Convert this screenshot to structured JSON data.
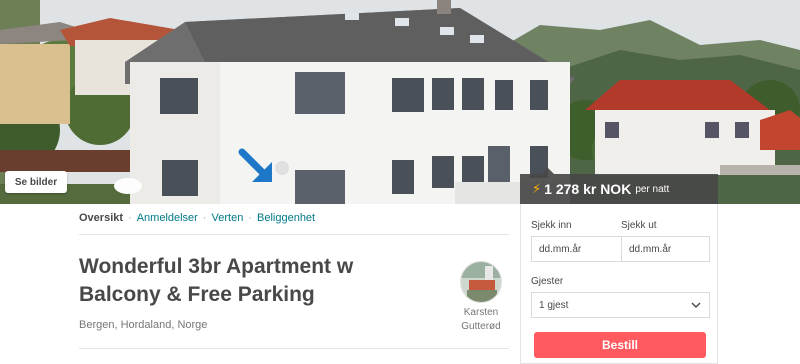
{
  "hero": {
    "see_photos_label": "Se bilder"
  },
  "price": {
    "amount": "1 278 kr NOK",
    "per_label": "per natt"
  },
  "subnav": {
    "items": [
      {
        "label": "Oversikt"
      },
      {
        "label": "Anmeldelser"
      },
      {
        "label": "Verten"
      },
      {
        "label": "Beliggenhet"
      }
    ],
    "separator": "·"
  },
  "listing": {
    "title_line1": "Wonderful 3br Apartment w",
    "title_line2": "Balcony & Free Parking",
    "location": "Bergen, Hordaland, Norge"
  },
  "host": {
    "first_name": "Karsten",
    "last_name": "Gutterød"
  },
  "booking": {
    "checkin_label": "Sjekk inn",
    "checkout_label": "Sjekk ut",
    "checkin_placeholder": "dd.mm.år",
    "checkout_placeholder": "dd.mm.år",
    "guests_label": "Gjester",
    "guests_value": "1 gjest",
    "book_label": "Bestill"
  },
  "colors": {
    "accent": "#ff5a5f",
    "link": "#007a87",
    "text": "#484848",
    "price_bar": "#484848",
    "bolt": "#ffb400"
  }
}
